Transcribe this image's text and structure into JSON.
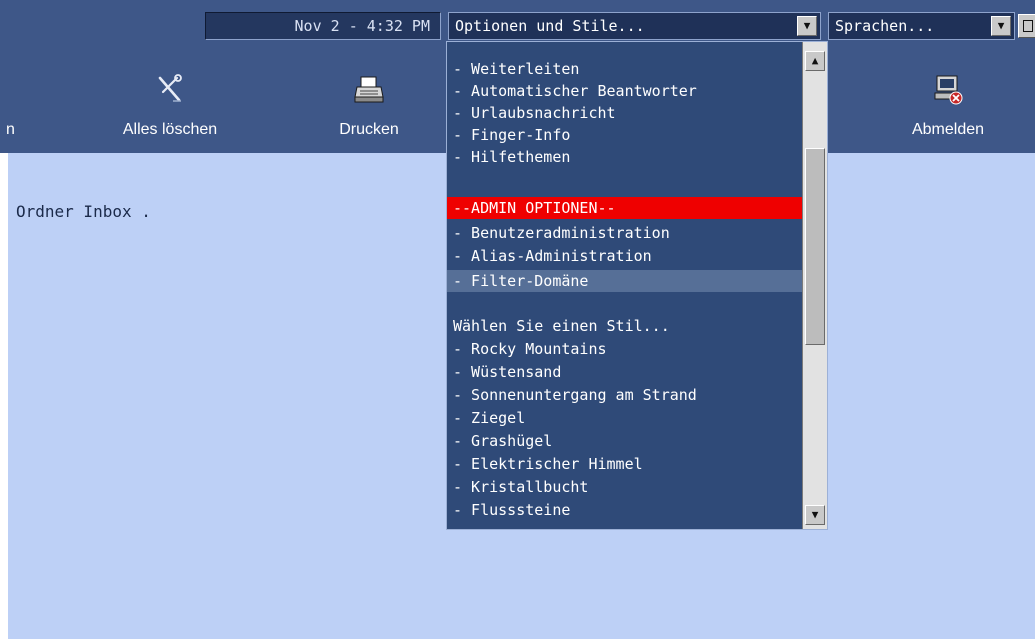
{
  "header": {
    "clock_text": "Nov 2 - 4:32 PM",
    "options_select_value": "Optionen und Stile...",
    "language_select_value": "Sprachen..."
  },
  "toolbar": {
    "prev_label": "n",
    "clear_all_label": "Alles löschen",
    "print_label": "Drucken",
    "logout_label": "Abmelden"
  },
  "content": {
    "folder_message": "Ordner Inbox ."
  },
  "options_dropdown": {
    "items": [
      "- Weiterleiten",
      "- Automatischer Beantworter",
      "- Urlaubsnachricht",
      "- Finger-Info",
      "- Hilfethemen",
      "",
      "--ADMIN OPTIONEN--",
      "- Benutzeradministration",
      "- Alias-Administration",
      "- Filter-Domäne",
      "",
      "Wählen Sie einen Stil...",
      "- Rocky Mountains",
      "- Wüstensand",
      "- Sonnenuntergang am Strand",
      "- Ziegel",
      "- Grashügel",
      "- Elektrischer Himmel",
      "- Kristallbucht",
      "- Flusssteine"
    ],
    "selected_item": "- Filter-Domäne",
    "highlight_color": "#ef0000"
  },
  "icons": {
    "clear_all": "tools-icon",
    "print": "printer-icon",
    "logout": "computer-logout-icon"
  }
}
